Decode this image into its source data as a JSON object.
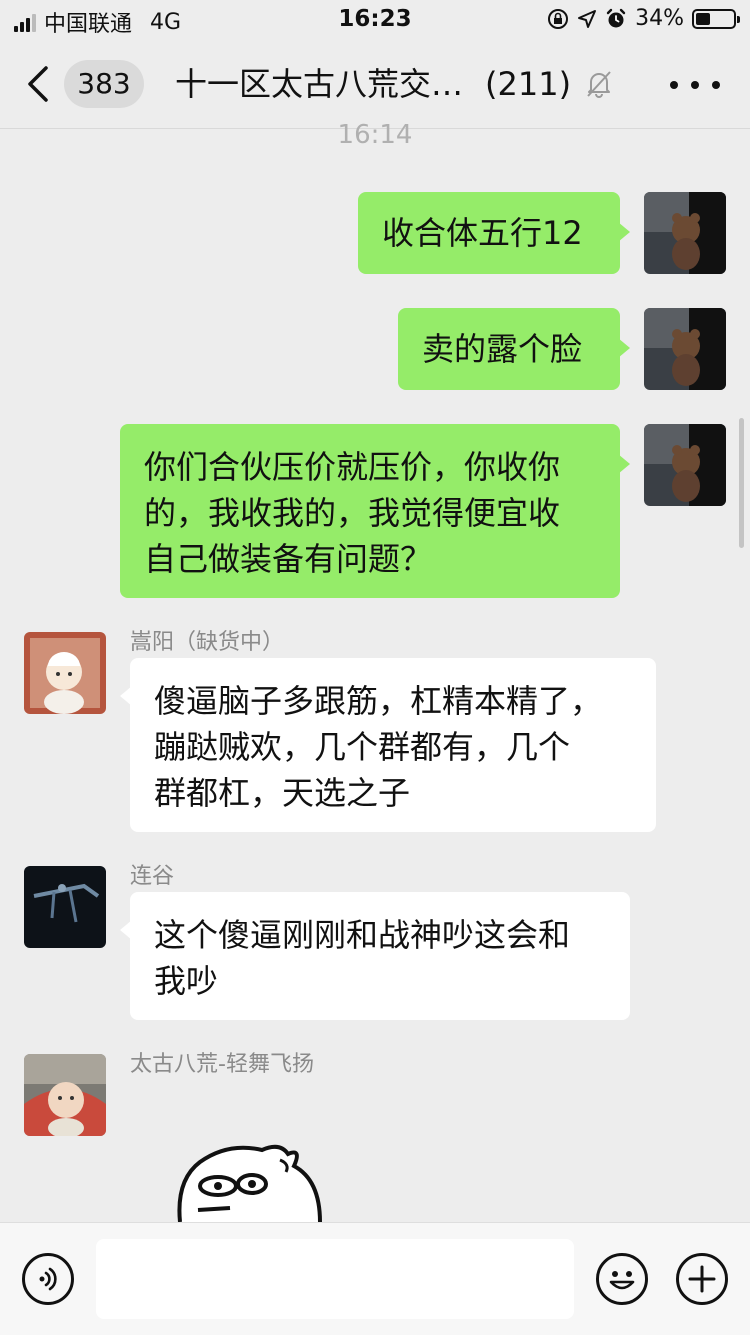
{
  "status_bar": {
    "carrier": "中国联通",
    "network": "4G",
    "time": "16:23",
    "battery_text": "34%",
    "battery_level": 0.34
  },
  "nav": {
    "unread_count": "383",
    "title": "十一区太古八荒交…",
    "member_count": "(211)"
  },
  "chat": {
    "timestamp": "16:14",
    "messages": [
      {
        "side": "me",
        "text": "收合体五行12"
      },
      {
        "side": "me",
        "text": "卖的露个脸"
      },
      {
        "side": "me",
        "lines": [
          "你们合伙压价就压价，你收你",
          "的，我收我的，我觉得便宜收",
          "自己做装备有问题？"
        ]
      },
      {
        "side": "them",
        "sender": "嵩阳（缺货中）",
        "lines": [
          "傻逼脑子多跟筋，杠精本精了，",
          "蹦跶贼欢，几个群都有，几个",
          "群都杠，天选之子"
        ]
      },
      {
        "side": "them",
        "sender": "连谷",
        "lines": [
          "这个傻逼刚刚和战神吵这会和",
          "我吵"
        ]
      },
      {
        "side": "them",
        "sender": "太古八荒-轻舞飞扬",
        "sticker": "sticker-face"
      }
    ]
  },
  "input": {
    "value": "",
    "placeholder": ""
  },
  "colors": {
    "background": "#ededed",
    "my_bubble": "#95ec69",
    "their_bubble": "#ffffff"
  },
  "icons": [
    "back-chevron-icon",
    "mute-bell-icon",
    "more-dots-icon",
    "voice-icon",
    "emoji-icon",
    "plus-icon"
  ]
}
